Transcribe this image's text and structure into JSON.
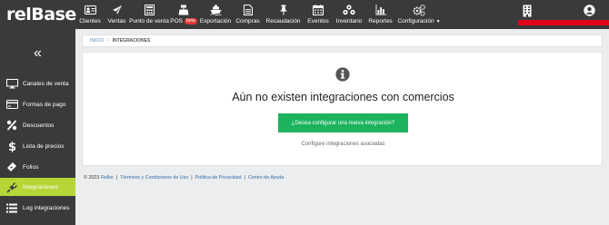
{
  "app": {
    "logo_main": "relBase"
  },
  "nav": {
    "items": [
      {
        "label": "Clientes",
        "icon": "id-card-icon"
      },
      {
        "label": "Ventas",
        "icon": "paper-plane-icon"
      },
      {
        "label": "Punto de venta",
        "icon": "calculator-icon"
      },
      {
        "label": "POS",
        "icon": "cash-register-icon",
        "badge": "beta"
      },
      {
        "label": "Exportación",
        "icon": "ship-icon"
      },
      {
        "label": "Compras",
        "icon": "document-icon"
      },
      {
        "label": "Recaudación",
        "icon": "pin-icon"
      },
      {
        "label": "Eventos",
        "icon": "calendar-icon"
      },
      {
        "label": "Inventario",
        "icon": "cubes-icon"
      },
      {
        "label": "Reportes",
        "icon": "bar-chart-icon"
      },
      {
        "label": "Configuración",
        "icon": "cogs-icon"
      }
    ]
  },
  "sidebar": {
    "collapse_glyph": "«",
    "items": [
      {
        "label": "Canales de venta",
        "icon": "monitor-icon"
      },
      {
        "label": "Formas de pago",
        "icon": "credit-card-icon"
      },
      {
        "label": "Descuentos",
        "icon": "percent-icon"
      },
      {
        "label": "Lista de precios",
        "icon": "dollar-icon"
      },
      {
        "label": "Folios",
        "icon": "ticket-icon"
      },
      {
        "label": "Integraciones",
        "icon": "plug-icon",
        "active": true
      },
      {
        "label": "Log integraciones",
        "icon": "list-icon"
      }
    ]
  },
  "breadcrumb": {
    "home": "INICIO",
    "sep": "/",
    "current": "INTEGRACIONES"
  },
  "main": {
    "empty_title": "Aún no existen integraciones con comercios",
    "cta_label": "¿Desea configurar una nueva integración?",
    "sub_link": "Configure integraciones asociadas"
  },
  "footer": {
    "copyright": "© 2023",
    "brand": "Relke",
    "sep": "|",
    "links": [
      "Términos y Condiciones de Uso",
      "Política de Privacidad",
      "Centro de Ayuda"
    ]
  },
  "colors": {
    "nav_bg": "#3a3a3a",
    "active_item": "#b6d638",
    "cta": "#1db35e",
    "link": "#2e6ca8",
    "redacted": "#e0001b"
  }
}
